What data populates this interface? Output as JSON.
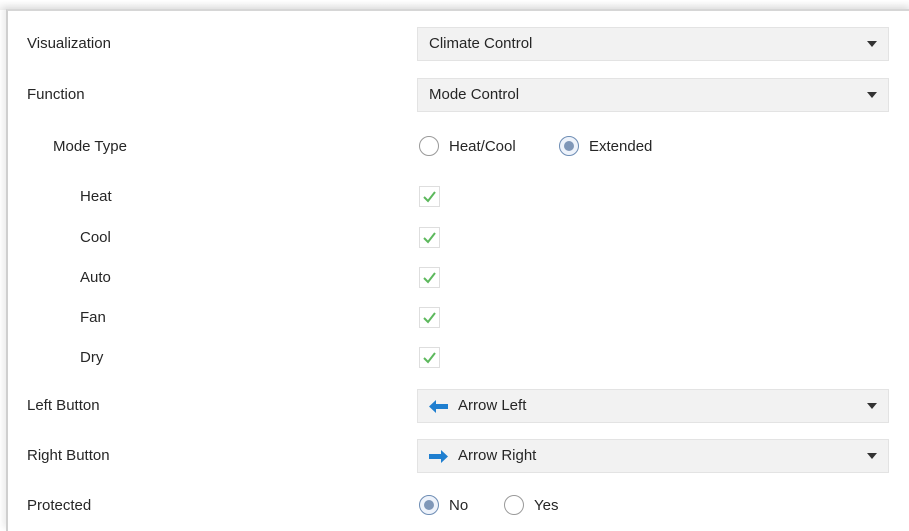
{
  "fields": {
    "visualization": {
      "label": "Visualization",
      "value": "Climate Control"
    },
    "function": {
      "label": "Function",
      "value": "Mode Control"
    },
    "mode_type": {
      "label": "Mode Type",
      "options": [
        "Heat/Cool",
        "Extended"
      ],
      "selected": "Extended"
    },
    "modes": [
      {
        "label": "Heat",
        "checked": true
      },
      {
        "label": "Cool",
        "checked": true
      },
      {
        "label": "Auto",
        "checked": true
      },
      {
        "label": "Fan",
        "checked": true
      },
      {
        "label": "Dry",
        "checked": true
      }
    ],
    "left_button": {
      "label": "Left Button",
      "value": "Arrow Left",
      "icon": "arrow-left-icon"
    },
    "right_button": {
      "label": "Right Button",
      "value": "Arrow Right",
      "icon": "arrow-right-icon"
    },
    "protected": {
      "label": "Protected",
      "options": [
        "No",
        "Yes"
      ],
      "selected": "No"
    }
  },
  "colors": {
    "check": "#5cb85c",
    "arrow": "#1f7fd0",
    "field_bg": "#f2f2f2",
    "radio_selected": "#7f97b8"
  }
}
